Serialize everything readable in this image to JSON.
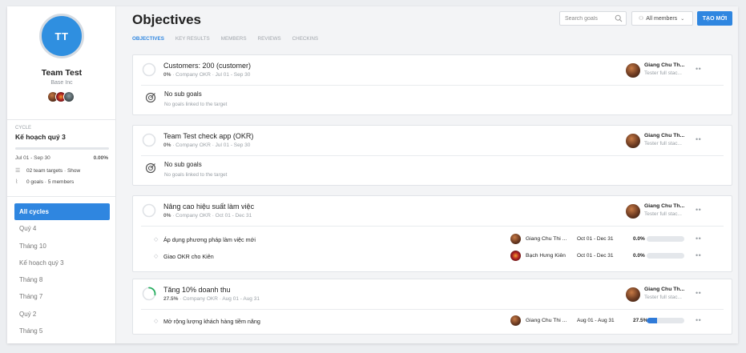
{
  "sidebar": {
    "avatar_initials": "TT",
    "team_name": "Team Test",
    "company": "Base Inc",
    "cycle_label": "CYCLE",
    "cycle_name": "Kế hoạch quý 3",
    "cycle_dates": "Jul 01 - Sep 30",
    "cycle_progress": "0.00%",
    "stats": [
      "02 team targets · Show",
      "0 goals · 5 members"
    ],
    "cycles": [
      "All cycles",
      "Quý 4",
      "Tháng 10",
      "Kế hoạch quý 3",
      "Tháng 8",
      "Tháng 7",
      "Quý 2",
      "Tháng 5"
    ],
    "active_cycle": 0
  },
  "header": {
    "title": "Objectives",
    "tabs": [
      "OBJECTIVES",
      "KEY RESULTS",
      "MEMBERS",
      "REVIEWS",
      "CHECKINS"
    ],
    "search_placeholder": "Search goals",
    "members_filter": "All members",
    "new_button": "TẠO MỚI"
  },
  "objectives": [
    {
      "title": "Customers: 200 (customer)",
      "progress": "0%",
      "meta": " · Company OKR · Jul 01 - Sep 30",
      "owner_name": "Giang Chu Th...",
      "owner_role": "Tester full stac...",
      "empty_title": "No sub goals",
      "empty_sub": "No goals linked to the target"
    },
    {
      "title": "Team Test check app (OKR)",
      "progress": "0%",
      "meta": " · Company OKR · Jul 01 - Sep 30",
      "owner_name": "Giang Chu Th...",
      "owner_role": "Tester full stac...",
      "empty_title": "No sub goals",
      "empty_sub": "No goals linked to the target"
    },
    {
      "title": "Nâng cao hiệu suất làm việc",
      "progress": "0%",
      "meta": " · Company OKR · Oct 01 - Dec 31",
      "owner_name": "Giang Chu Th...",
      "owner_role": "Tester full stac...",
      "key_results": [
        {
          "title": "Áp dụng phương pháp làm việc mới",
          "owner": "Giang Chu Thi ...",
          "dates": "Oct 01 - Dec 31",
          "pct": "0.0%",
          "fill": 0
        },
        {
          "title": "Giao OKR cho Kiên",
          "owner": "Bạch Hưng Kiên",
          "dates": "Oct 01 - Dec 31",
          "pct": "0.0%",
          "fill": 0
        }
      ]
    },
    {
      "title": "Tăng 10% doanh thu",
      "progress": "27.5%",
      "meta": " · Company OKR · Aug 01 - Aug 31",
      "owner_name": "Giang Chu Th...",
      "owner_role": "Tester full stac...",
      "key_results": [
        {
          "title": "Mở rộng lượng khách hàng tiềm năng",
          "owner": "Giang Chu Thi ...",
          "dates": "Aug 01 - Aug 31",
          "pct": "27.5%",
          "fill": 0.275
        }
      ]
    }
  ],
  "colors": {
    "accent": "#2f86e0",
    "progress_green": "#27ae60"
  }
}
